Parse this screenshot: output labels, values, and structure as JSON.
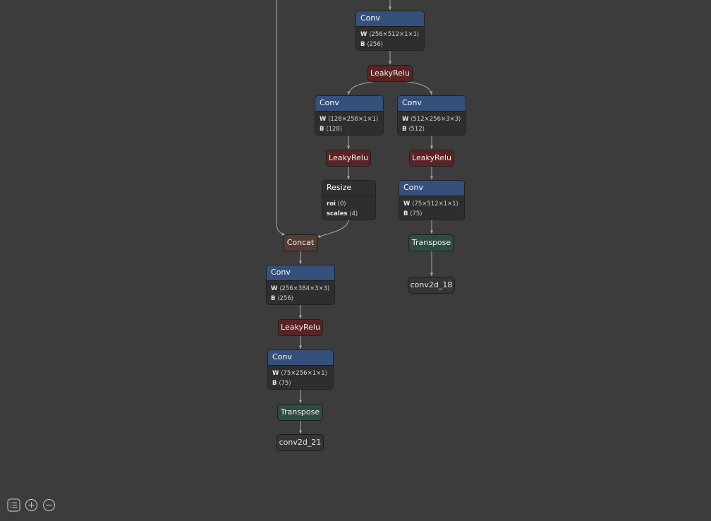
{
  "nodes": {
    "conv_top": {
      "title": "Conv",
      "w": "⟨256×512×1×1⟩",
      "b": "⟨256⟩"
    },
    "relu_top": {
      "title": "LeakyRelu"
    },
    "conv_l1": {
      "title": "Conv",
      "w": "⟨128×256×1×1⟩",
      "b": "⟨128⟩"
    },
    "conv_r1": {
      "title": "Conv",
      "w": "⟨512×256×3×3⟩",
      "b": "⟨512⟩"
    },
    "relu_l1": {
      "title": "LeakyRelu"
    },
    "relu_r1": {
      "title": "LeakyRelu"
    },
    "resize": {
      "title": "Resize",
      "roi": "⟨0⟩",
      "scales": "⟨4⟩"
    },
    "conv_r2": {
      "title": "Conv",
      "w": "⟨75×512×1×1⟩",
      "b": "⟨75⟩"
    },
    "transpose_r": {
      "title": "Transpose"
    },
    "output_r": {
      "title": "conv2d_18"
    },
    "concat": {
      "title": "Concat"
    },
    "conv_l2": {
      "title": "Conv",
      "w": "⟨256×384×3×3⟩",
      "b": "⟨256⟩"
    },
    "relu_l2": {
      "title": "LeakyRelu"
    },
    "conv_l3": {
      "title": "Conv",
      "w": "⟨75×256×1×1⟩",
      "b": "⟨75⟩"
    },
    "transpose_l": {
      "title": "Transpose"
    },
    "output_l": {
      "title": "conv2d_21"
    }
  },
  "labels": {
    "w": "W",
    "b": "B",
    "roi": "roi",
    "scales": "scales"
  },
  "colors": {
    "conv": "#35507a",
    "relu": "#5a2424",
    "concat": "#533c35",
    "transpose": "#2d4d3e",
    "edge": "#a8a8a8",
    "background": "#3c3c3c"
  },
  "toolbar": {
    "icons": [
      "list-icon",
      "zoom-in-icon",
      "zoom-out-icon"
    ]
  }
}
